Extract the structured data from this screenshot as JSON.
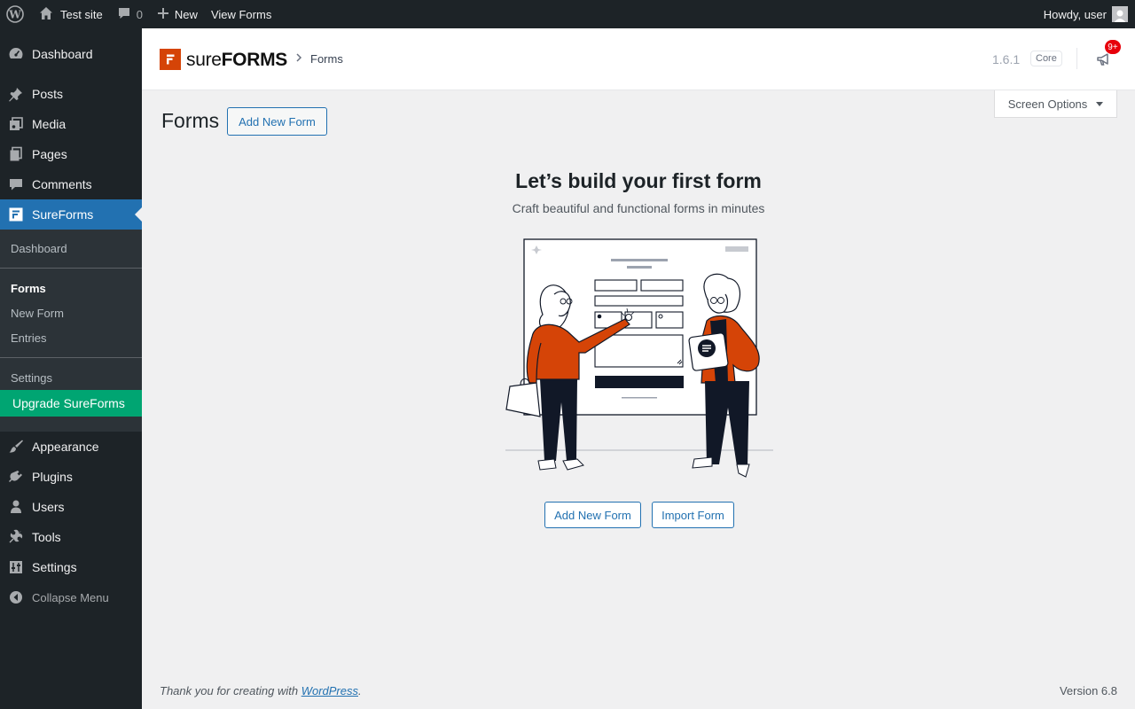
{
  "adminbar": {
    "site_name": "Test site",
    "comments_count": "0",
    "new_label": "New",
    "view_forms_label": "View Forms",
    "howdy": "Howdy, user"
  },
  "sidebar": {
    "items": [
      {
        "label": "Dashboard",
        "icon": "dashboard-icon"
      },
      {
        "label": "Posts",
        "icon": "pin-icon"
      },
      {
        "label": "Media",
        "icon": "media-icon"
      },
      {
        "label": "Pages",
        "icon": "pages-icon"
      },
      {
        "label": "Comments",
        "icon": "comments-icon"
      },
      {
        "label": "SureForms",
        "icon": "sureforms-icon"
      },
      {
        "label": "Appearance",
        "icon": "brush-icon"
      },
      {
        "label": "Plugins",
        "icon": "plugin-icon"
      },
      {
        "label": "Users",
        "icon": "users-icon"
      },
      {
        "label": "Tools",
        "icon": "wrench-icon"
      },
      {
        "label": "Settings",
        "icon": "settings-icon"
      }
    ],
    "submenu": {
      "dashboard": "Dashboard",
      "forms": "Forms",
      "new_form": "New Form",
      "entries": "Entries",
      "settings": "Settings",
      "upgrade": "Upgrade SureForms"
    },
    "collapse": "Collapse Menu"
  },
  "header": {
    "brand_sure": "sure",
    "brand_forms": "FORMS",
    "breadcrumb": "Forms",
    "version": "1.6.1",
    "core_badge": "Core",
    "notif_count": "9+"
  },
  "screen_options": "Screen Options",
  "page": {
    "title": "Forms",
    "add_new_button": "Add New Form"
  },
  "empty_state": {
    "title": "Let’s build your first form",
    "subtitle": "Craft beautiful and functional forms in minutes",
    "add_button": "Add New Form",
    "import_button": "Import Form"
  },
  "footer": {
    "thanks_prefix": "Thank you for creating with ",
    "wordpress_link": "WordPress",
    "thanks_suffix": ".",
    "version": "Version 6.8"
  },
  "colors": {
    "accent": "#2271b1",
    "brand": "#d54407",
    "upgrade": "#00a572",
    "sidebar_bg": "#1d2327"
  }
}
